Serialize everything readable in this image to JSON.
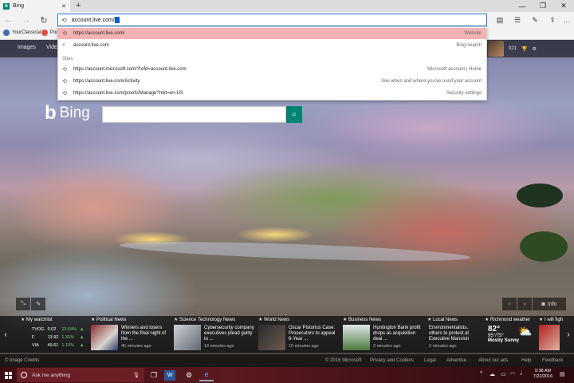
{
  "tab": {
    "title": "Bing",
    "favicon": "b",
    "close": "✕",
    "new_tab": "+"
  },
  "window_controls": {
    "minimize": "—",
    "restore": "❐",
    "close": "✕"
  },
  "address_bar": {
    "value": "account.live.com/"
  },
  "favorites": [
    {
      "label": "YourClassical",
      "color": "#3a6db5"
    },
    {
      "label": "Poo",
      "color": "#e24c3f"
    }
  ],
  "bing_header": {
    "nav": [
      "Images",
      "Vide"
    ],
    "right_label": "nger",
    "rewards_count": "321"
  },
  "dropdown": {
    "items_top": [
      {
        "url": "https://account.live.com/",
        "hint": "Website",
        "icon": "history-icon",
        "selected": true
      },
      {
        "url": "account.live.com",
        "hint": "Bing search",
        "icon": "search-icon",
        "selected": false
      }
    ],
    "sites_label": "Sites",
    "sites": [
      {
        "url": "https://account.microsoft.com/?refd=account.live.com",
        "hint": "Microsoft account | Home"
      },
      {
        "url": "https://account.live.com/Activity",
        "hint": "See when and where you've used your account"
      },
      {
        "url": "https://account.live.com/proofs/Manage?mkt=en-US",
        "hint": "Security settings"
      }
    ]
  },
  "search": {
    "logo_word": "Bing",
    "logo_mark": "b"
  },
  "image_nav": {
    "prev": "‹",
    "next": "›",
    "info": "Info"
  },
  "news": {
    "watchlist": {
      "title": "My watchlist",
      "rows": [
        {
          "sym": "TVOG",
          "price": "0.02",
          "change": "13.64%"
        },
        {
          "sym": "F",
          "price": "13.92",
          "change": "1.31%"
        },
        {
          "sym": "VIA",
          "price": "49.61",
          "change": "1.10%"
        }
      ]
    },
    "items": [
      {
        "category": "Political News",
        "text": "Winners and losers from the final night of the ...",
        "time": "45 minutes ago",
        "thumb": "#7a2a2a"
      },
      {
        "category": "Science Technology News",
        "text": "Cybersecurity company executives plead guilty to ...",
        "time": "19 minutes ago",
        "thumb": "#5f6670"
      },
      {
        "category": "World News",
        "text": "Oscar Pistorius Case: Prosecutors to appeal 6-Year ...",
        "time": "10 minutes ago",
        "thumb": "#3a3a40"
      },
      {
        "category": "Business News",
        "text": "Huntington Bank profit drops as acquisition deal ...",
        "time": "3 minutes ago",
        "thumb": "#4e7a3a"
      },
      {
        "category": "Local News",
        "text": "Environmentalists, others to protest at Executive Mansion",
        "time": "2 minutes ago",
        "thumb": ""
      }
    ],
    "weather": {
      "category": "Richmond weather",
      "temp": "82°",
      "range": "95°/75°",
      "condition": "Mostly Sunny"
    },
    "trailing": {
      "category": "I will figh"
    }
  },
  "footer": {
    "left": "© Image Credits",
    "links": [
      "© 2016 Microsoft",
      "Privacy and Cookies",
      "Legal",
      "Advertise",
      "About our ads",
      "Help",
      "Feedback"
    ]
  },
  "taskbar": {
    "search_placeholder": "Ask me anything",
    "time": "9:38 AM",
    "date": "7/22/2016"
  }
}
